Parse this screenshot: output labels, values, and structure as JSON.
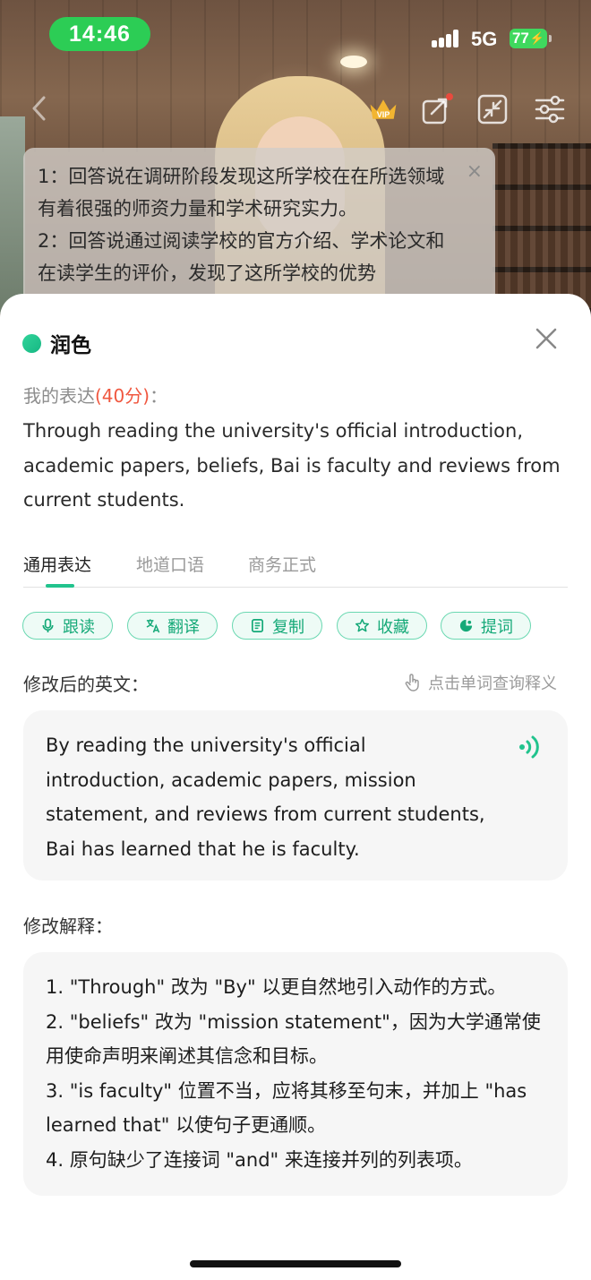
{
  "status_bar": {
    "time": "14:46",
    "network": "5G",
    "battery": "77"
  },
  "toolbar": {
    "back_icon": "chevron-left-icon",
    "vip_icon": "vip-crown-icon",
    "vip_text": "VIP",
    "share_icon": "share-icon",
    "minimize_icon": "minimize-icon",
    "settings_icon": "sliders-icon"
  },
  "hint_card": {
    "line1": "1：回答说在调研阶段发现这所学校在在所选领域有着很强的师资力量和学术研究实力。",
    "line2": "2：回答说通过阅读学校的官方介绍、学术论文和在读学生的评价，发现了这所学校的优势",
    "close": "×"
  },
  "sheet": {
    "title": "润色",
    "my_expression_label": "我的表达",
    "score_text": "(40分)",
    "colon": "：",
    "my_expression": "Through reading the university's official introduction, academic papers, beliefs, Bai is faculty and reviews from current students.",
    "tabs": [
      {
        "label": "通用表达",
        "active": true
      },
      {
        "label": "地道口语",
        "active": false
      },
      {
        "label": "商务正式",
        "active": false
      }
    ],
    "actions": [
      {
        "label": "跟读",
        "icon": "microphone-icon"
      },
      {
        "label": "翻译",
        "icon": "translate-icon"
      },
      {
        "label": "复制",
        "icon": "copy-icon"
      },
      {
        "label": "收藏",
        "icon": "star-icon"
      },
      {
        "label": "提词",
        "icon": "prompt-icon"
      }
    ],
    "revised_label": "修改后的英文：",
    "lookup_hint": "点击单词查询释义",
    "revised_text": "By reading the university's official introduction, academic papers, mission statement, and reviews from current students, Bai has learned that he is faculty.",
    "explanation_label": "修改解释：",
    "explanations": [
      "1. \"Through\" 改为 \"By\" 以更自然地引入动作的方式。",
      "2. \"beliefs\" 改为 \"mission statement\"，因为大学通常使用使命声明来阐述其信念和目标。",
      "3. \"is faculty\" 位置不当，应将其移至句末，并加上 \"has learned that\" 以使句子更通顺。",
      "4. 原句缺少了连接词 \"and\" 来连接并列的列表项。"
    ]
  },
  "colors": {
    "accent": "#21c38d",
    "score": "#f0573f",
    "time_pill": "#2ccd55"
  }
}
